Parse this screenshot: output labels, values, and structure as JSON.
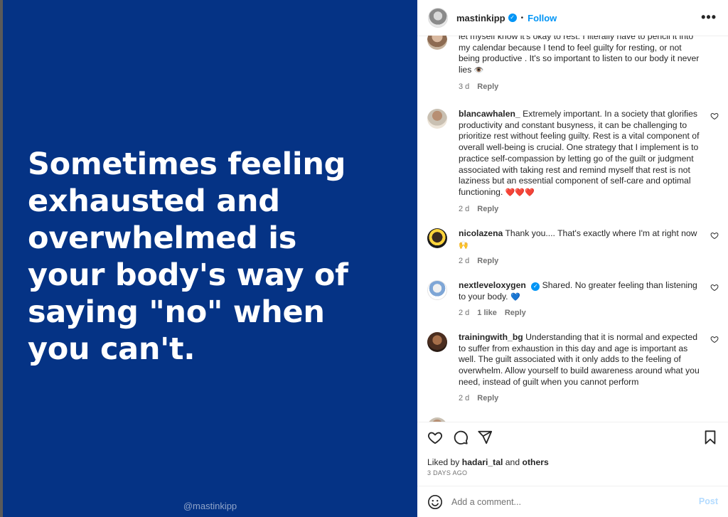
{
  "post": {
    "quote": "Sometimes feeling\nexhausted and\noverwhelmed is\nyour body's way of\nsaying \"no\" when\nyou can't.",
    "watermark": "@mastinkipp"
  },
  "header": {
    "username": "mastinkipp",
    "separator": "•",
    "follow_label": "Follow",
    "more_icon": "more-options-icon",
    "more_label": "•••"
  },
  "comments": [
    {
      "username": "",
      "text": "let myself know it's okay to rest. I literally have to pencil it into my calendar because I tend to feel guilty for resting, or not being productive . It's so important to listen to our body it never lies",
      "emoji": "👁️",
      "time": "3 d",
      "likes": "",
      "reply": "Reply"
    },
    {
      "username": "blancawhalen_",
      "text": "Extremely important. In a society that glorifies productivity and constant busyness, it can be challenging to prioritize rest without feeling guilty. Rest is a vital component of overall well-being is crucial. One strategy that I implement is to practice self-compassion by letting go of the guilt or judgment associated with taking rest and remind myself that rest is not laziness but an essential component of self-care and optimal functioning.",
      "emoji": "❤️❤️❤️",
      "time": "2 d",
      "likes": "",
      "reply": "Reply"
    },
    {
      "username": "nicolazena",
      "text": "Thank you.... That's exactly where I'm at right now",
      "emoji": "🙌",
      "time": "2 d",
      "likes": "",
      "reply": "Reply"
    },
    {
      "username": "nextleveloxygen",
      "text": "Shared. No greater feeling than listening to your body.",
      "emoji": "💙",
      "time": "2 d",
      "likes": "1 like",
      "reply": "Reply"
    },
    {
      "username": "trainingwith_bg",
      "text": "Understanding that it is normal and expected to suffer from exhaustion in this day and age is important as well. The guilt associated with it only adds to the feeling of overwhelm. Allow yourself to build awareness around what you need, instead of guilt when you cannot perform",
      "emoji": "",
      "time": "2 d",
      "likes": "",
      "reply": "Reply"
    }
  ],
  "footer": {
    "liked_by_prefix": "Liked by",
    "liked_by_user": "hadari_tal",
    "liked_by_and": "and",
    "liked_by_others": "others",
    "date": "3 DAYS AGO",
    "comment_placeholder": "Add a comment...",
    "post_label": "Post"
  },
  "colors": {
    "post_background": "#053385",
    "accent": "#0095f6",
    "heart_red": "#ed4956"
  }
}
